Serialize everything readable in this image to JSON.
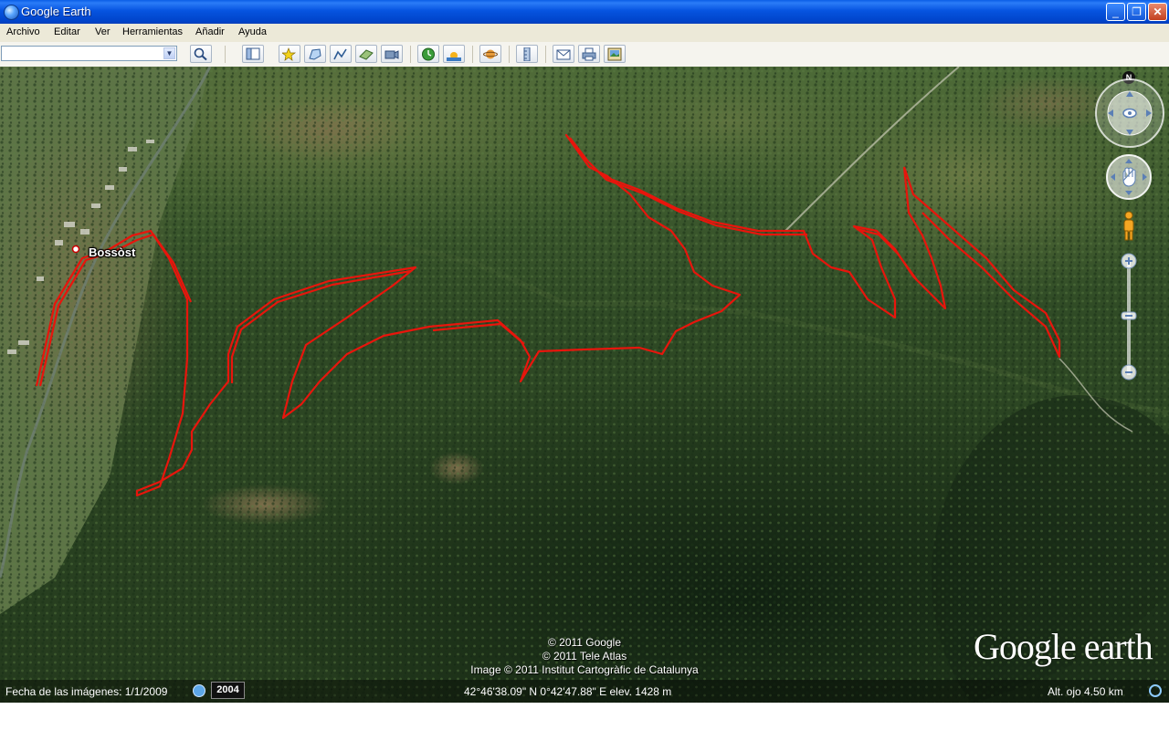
{
  "window": {
    "title": "Google Earth",
    "controls": {
      "minimize": "_",
      "maximize": "❐",
      "close": "✕"
    }
  },
  "menu": {
    "items": [
      "Archivo",
      "Editar",
      "Ver",
      "Herramientas",
      "Añadir",
      "Ayuda"
    ]
  },
  "toolbar": {
    "search_value": "",
    "icons": [
      "search-icon",
      "sidebar-toggle-icon",
      "placemark-icon",
      "polygon-icon",
      "path-icon",
      "image-overlay-icon",
      "record-tour-icon",
      "historical-imagery-icon",
      "sunlight-icon",
      "planets-icon",
      "ruler-icon",
      "email-icon",
      "print-icon",
      "save-image-icon"
    ]
  },
  "map": {
    "place_label": "Bossòst",
    "attribution": [
      "© 2011 Google",
      "© 2011 Tele Atlas",
      "Image © 2011 Institut Cartogràfic de Catalunya"
    ],
    "logo_text": "Google earth",
    "north_label": "N"
  },
  "status": {
    "imagery_date": "Fecha de las imágenes: 1/1/2009",
    "year": "2004",
    "coordinates": "42°46'38.09\" N   0°42'47.88\" E  elev.  1428 m",
    "eye_alt": "Alt. ojo    4.50 km"
  },
  "colors": {
    "track": "#e8150c",
    "titlebar": "#0a56e0",
    "forest_dark": "#1f3d1c",
    "forest_light": "#4f6e34"
  }
}
